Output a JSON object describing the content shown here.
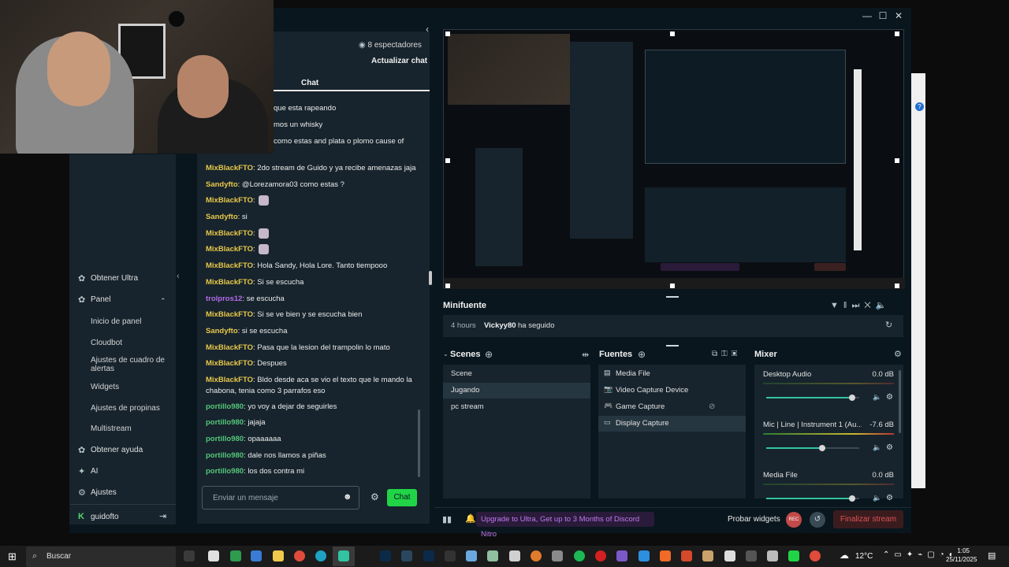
{
  "window": {
    "controls": {
      "minimize": "—",
      "maximize": "☐",
      "close": "✕"
    }
  },
  "chat": {
    "viewers": "8 espectadores",
    "refresh": "Actualizar chat",
    "title": "Chat",
    "partial_lines": [
      {
        "text": "que esta rapeando"
      },
      {
        "text": "mos un whisky"
      },
      {
        "text": "como estas and plata o plomo cause of"
      }
    ],
    "messages": [
      {
        "user": "MixBlackFTO",
        "cls": "u-mix",
        "text": ": 2do stream de Guido y ya recibe amenazas jaja",
        "emote": false
      },
      {
        "user": "Sandyfto",
        "cls": "u-sandy",
        "text": ": @Lorezamora03 como estas ?",
        "emote": false
      },
      {
        "user": "MixBlackFTO",
        "cls": "u-mix",
        "text": ":",
        "emote": true
      },
      {
        "user": "Sandyfto",
        "cls": "u-sandy",
        "text": ": si",
        "emote": false
      },
      {
        "user": "MixBlackFTO",
        "cls": "u-mix",
        "text": ":",
        "emote": true
      },
      {
        "user": "MixBlackFTO",
        "cls": "u-mix",
        "text": ":",
        "emote": true
      },
      {
        "user": "MixBlackFTO",
        "cls": "u-mix",
        "text": ": Hola Sandy, Hola Lore. Tanto tiempooo",
        "emote": false
      },
      {
        "user": "MixBlackFTO",
        "cls": "u-mix",
        "text": ": Si se escucha",
        "emote": false
      },
      {
        "user": "trolpros12",
        "cls": "u-trol",
        "text": ": se escucha",
        "emote": false
      },
      {
        "user": "MixBlackFTO",
        "cls": "u-mix",
        "text": ": Si se ve bien y se escucha bien",
        "emote": false
      },
      {
        "user": "Sandyfto",
        "cls": "u-sandy",
        "text": ": si se escucha",
        "emote": false
      },
      {
        "user": "MixBlackFTO",
        "cls": "u-mix",
        "text": ": Pasa que la lesion del trampolin lo mato",
        "emote": false
      },
      {
        "user": "MixBlackFTO",
        "cls": "u-mix",
        "text": ": Despues",
        "emote": false
      },
      {
        "user": "MixBlackFTO",
        "cls": "u-mix",
        "text": ": Bldo desde aca se vio el texto que le mando la chabona, tenia como 3 parrafos eso",
        "emote": false
      },
      {
        "user": "portillo980",
        "cls": "u-port",
        "text": ": yo voy a dejar de seguirles",
        "emote": false
      },
      {
        "user": "portillo980",
        "cls": "u-port",
        "text": ": jajaja",
        "emote": false
      },
      {
        "user": "portillo980",
        "cls": "u-port",
        "text": ": opaaaaaa",
        "emote": false
      },
      {
        "user": "portillo980",
        "cls": "u-port",
        "text": ": dale nos llamos a piñas",
        "emote": false
      },
      {
        "user": "portillo980",
        "cls": "u-port",
        "text": ": los dos contra mi",
        "emote": false
      }
    ],
    "input_placeholder": "Enviar un mensaje",
    "send_label": "Chat"
  },
  "nav": {
    "ultra": "Obtener Ultra",
    "panel": "Panel",
    "sub": [
      "Inicio de panel",
      "Cloudbot",
      "Ajustes de cuadro de alertas",
      "Widgets",
      "Ajustes de propinas",
      "Multistream"
    ],
    "help": "Obtener ayuda",
    "ai": "AI",
    "settings": "Ajustes",
    "user": "guidofto"
  },
  "minifeed": {
    "title": "Minifuente",
    "time": "4 hours",
    "user": "Vickyy80",
    "action": "ha seguido"
  },
  "scenes": {
    "title": "Scenes",
    "items": [
      "Scene",
      "Jugando",
      "pc stream"
    ],
    "selected": 1
  },
  "sources": {
    "title": "Fuentes",
    "items": [
      "Media File",
      "Video Capture Device",
      "Game Capture",
      "Display Capture"
    ],
    "selected": 3
  },
  "mixer": {
    "title": "Mixer",
    "channels": [
      {
        "name": "Desktop Audio",
        "db": "0.0 dB",
        "level": 0.92
      },
      {
        "name": "Mic | Line | Instrument 1 (Au...",
        "db": "-7.6 dB",
        "level": 0.6
      },
      {
        "name": "Media File",
        "db": "0.0 dB",
        "level": 0.92
      }
    ]
  },
  "footer": {
    "promo": "Upgrade to Ultra, Get up to 3 Months of Discord Nitro",
    "test_widgets": "Probar widgets",
    "rec": "REC",
    "end_stream": "Finalizar stream"
  },
  "taskbar": {
    "search": "Buscar",
    "temp": "12°C",
    "time": "1:05",
    "date": "25/11/2025"
  },
  "colors": {
    "accent": "#31c3a2",
    "chat_send": "#21d447",
    "end_stream": "#e05252",
    "promo": "#c07af0"
  }
}
